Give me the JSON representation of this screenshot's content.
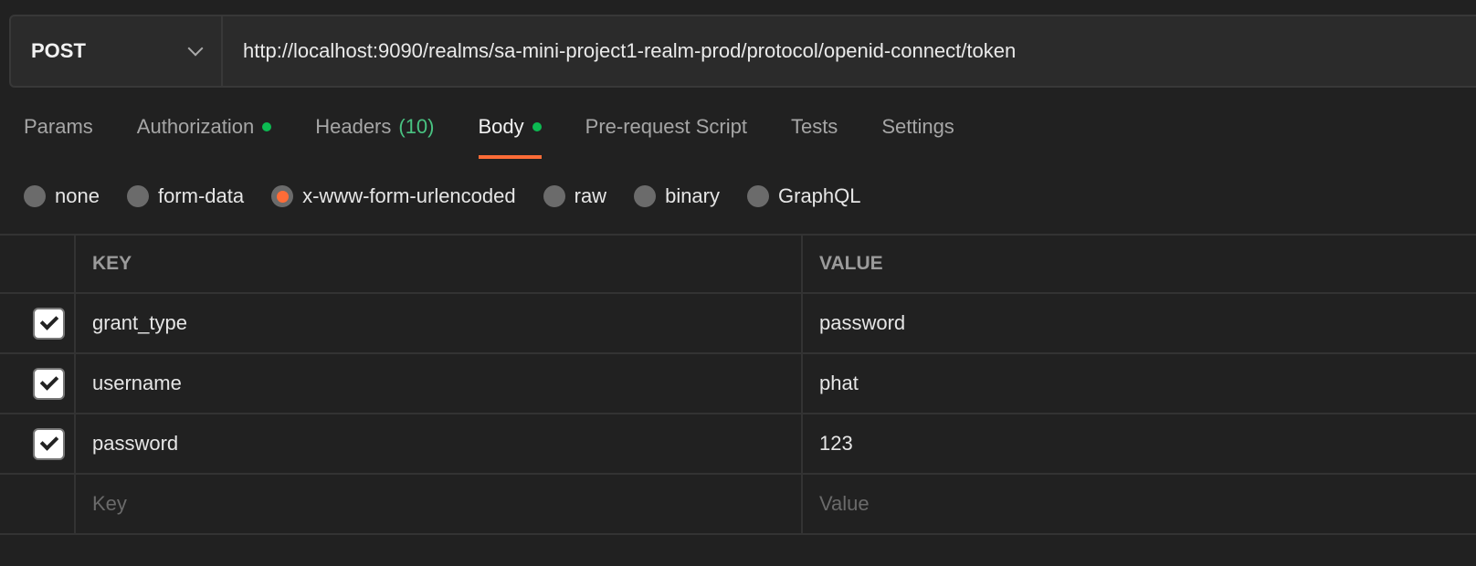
{
  "request": {
    "method": "POST",
    "url": "http://localhost:9090/realms/sa-mini-project1-realm-prod/protocol/openid-connect/token"
  },
  "tabs": [
    {
      "label": "Params"
    },
    {
      "label": "Authorization",
      "dot": true
    },
    {
      "label": "Headers",
      "count": "(10)"
    },
    {
      "label": "Body",
      "dot": true,
      "active": true
    },
    {
      "label": "Pre-request Script"
    },
    {
      "label": "Tests"
    },
    {
      "label": "Settings"
    }
  ],
  "body_types": [
    "none",
    "form-data",
    "x-www-form-urlencoded",
    "raw",
    "binary",
    "GraphQL"
  ],
  "selected_body_type": "x-www-form-urlencoded",
  "table": {
    "headers": {
      "key": "KEY",
      "value": "VALUE"
    },
    "rows": [
      {
        "key": "grant_type",
        "value": "password",
        "checked": true
      },
      {
        "key": "username",
        "value": "phat",
        "checked": true
      },
      {
        "key": "password",
        "value": "123",
        "checked": true
      }
    ],
    "placeholder": {
      "key": "Key",
      "value": "Value"
    }
  },
  "colors": {
    "accent": "#ff6c37",
    "status_dot": "#0cbb52",
    "count": "#49c382"
  }
}
